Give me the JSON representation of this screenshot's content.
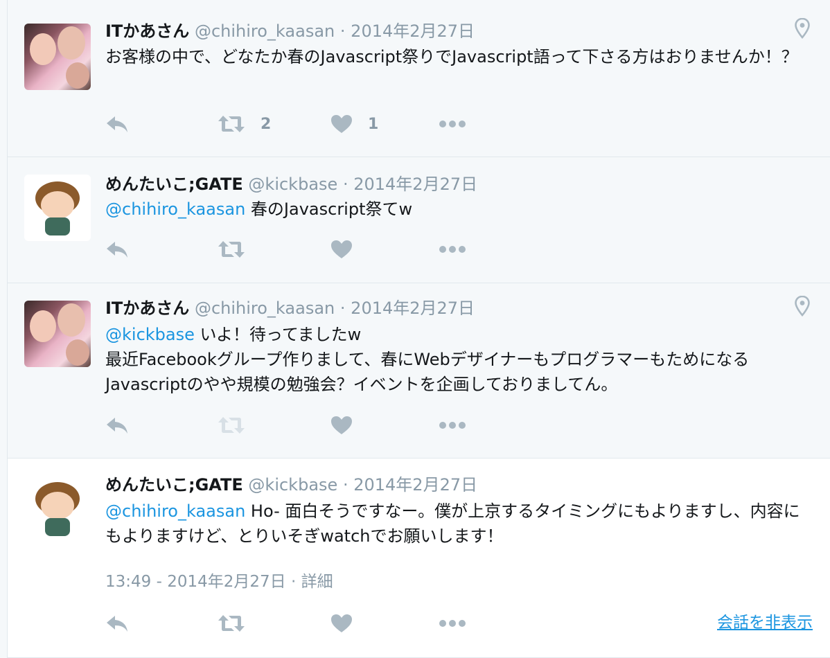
{
  "colors": {
    "background": "#f5f8fa",
    "focused_background": "#ffffff",
    "link": "#1b95e0",
    "muted": "#8899a6",
    "text": "#14171a"
  },
  "tweets": [
    {
      "name": "ITかあさん",
      "handle": "@chihiro_kaasan",
      "separator": "·",
      "date": "2014年2月27日",
      "avatar": "child-photo-avatar",
      "has_location": true,
      "mention": "",
      "text": "お客様の中で、どなたか春のJavascript祭りでJavascript語って下さる方はおりませんか！？",
      "retweet_count": "2",
      "like_count": "1"
    },
    {
      "name": "めんたいこ;GATE",
      "handle": "@kickbase",
      "separator": "·",
      "date": "2014年2月27日",
      "avatar": "cartoon-avatar",
      "has_location": false,
      "mention": "@chihiro_kaasan",
      "text": " 春のJavascript祭てw",
      "retweet_count": "",
      "like_count": ""
    },
    {
      "name": "ITかあさん",
      "handle": "@chihiro_kaasan",
      "separator": "·",
      "date": "2014年2月27日",
      "avatar": "child-photo-avatar",
      "has_location": true,
      "mention": "@kickbase",
      "text": " いよ！待ってましたw",
      "text2": "最近Facebookグループ作りまして、春にWebデザイナーもプログラマーもためになるJavascriptのやや規模の勉強会？イベントを企画しておりましてん。",
      "retweet_count": "",
      "like_count": ""
    },
    {
      "name": "めんたいこ;GATE",
      "handle": "@kickbase",
      "separator": "·",
      "date": "2014年2月27日",
      "avatar": "cartoon-avatar",
      "has_location": false,
      "mention": "@chihiro_kaasan",
      "text": " Ho- 面白そうですなー。僕が上京するタイミングにもよりますし、内容にもよりますけど、とりいそぎwatchでお願いします！",
      "timestamp": "13:49 - 2014年2月27日",
      "details_link": "詳細",
      "hide_conversation": "会話を非表示",
      "retweet_count": "",
      "like_count": ""
    }
  ]
}
